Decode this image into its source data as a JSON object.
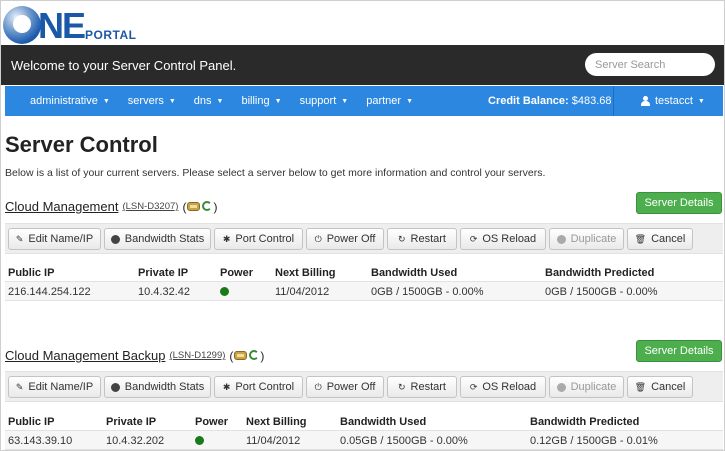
{
  "logo": {
    "brand": "NE",
    "sub": "PORTAL"
  },
  "header": {
    "welcome": "Welcome to your Server Control Panel.",
    "search_placeholder": "Server Search"
  },
  "nav": {
    "items": [
      {
        "label": "administrative"
      },
      {
        "label": "servers"
      },
      {
        "label": "dns"
      },
      {
        "label": "billing"
      },
      {
        "label": "support"
      },
      {
        "label": "partner"
      }
    ],
    "credit_label": "Credit Balance:",
    "credit_amount": "$483.68",
    "user": "testacct"
  },
  "page": {
    "title": "Server Control",
    "description": "Below is a list of your current servers. Please select a server below to get more information and control your servers."
  },
  "actions": {
    "details": "Server Details",
    "edit": "Edit Name/IP",
    "bandwidth": "Bandwidth Stats",
    "port": "Port Control",
    "power": "Power Off",
    "restart": "Restart",
    "reload": "OS Reload",
    "duplicate": "Duplicate",
    "cancel": "Cancel"
  },
  "columns": {
    "public_ip": "Public IP",
    "private_ip": "Private IP",
    "power": "Power",
    "next_billing": "Next Billing",
    "bw_used": "Bandwidth Used",
    "bw_predicted": "Bandwidth Predicted"
  },
  "servers": [
    {
      "name": "Cloud Management",
      "code": "(LSN-D3207)",
      "public_ip": "216.144.254.122",
      "private_ip": "10.4.32.42",
      "power_color": "#1a7a1a",
      "next_billing": "11/04/2012",
      "bw_used": "0GB / 1500GB - 0.00%",
      "bw_predicted": "0GB / 1500GB - 0.00%"
    },
    {
      "name": "Cloud Management Backup",
      "code": "(LSN-D1299)",
      "public_ip": "63.143.39.10",
      "private_ip": "10.4.32.202",
      "power_color": "#1a7a1a",
      "next_billing": "11/04/2012",
      "bw_used": "0.05GB / 1500GB - 0.00%",
      "bw_predicted": "0.12GB / 1500GB - 0.01%"
    }
  ],
  "colors": {
    "nav": "#2c87e0",
    "header": "#2a2a2a",
    "success": "#4cae4c"
  }
}
